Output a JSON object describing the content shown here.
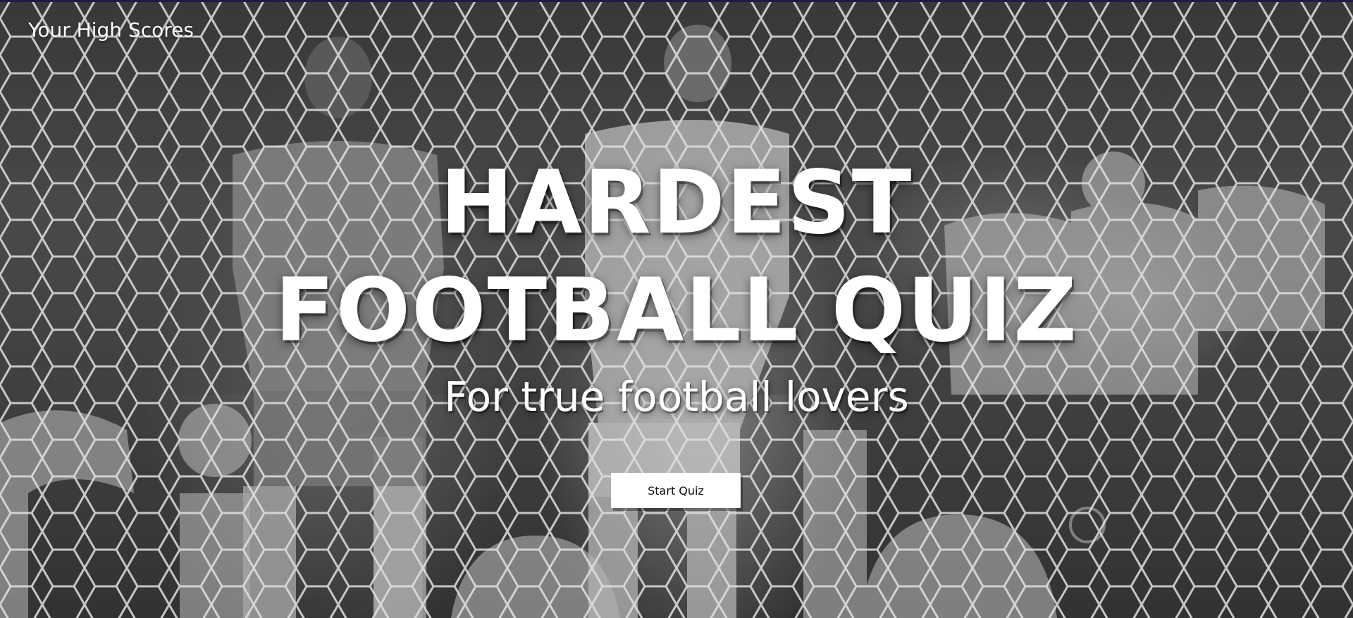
{
  "header": {
    "high_scores_label": "Your High Scores"
  },
  "hero": {
    "title_line_1": "HARDEST",
    "title_line_2": "FOOTBALL QUIZ",
    "subtitle": "For true football lovers",
    "start_button_label": "Start Quiz"
  },
  "colors": {
    "text": "#ffffff",
    "button_background": "#ffffff",
    "button_text": "#111111",
    "top_strip": "#1e1b4b"
  }
}
